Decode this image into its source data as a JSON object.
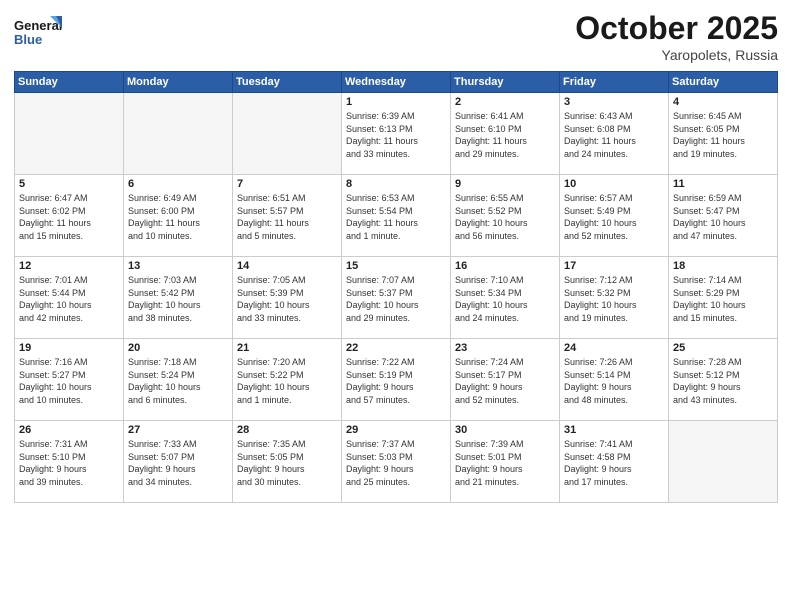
{
  "header": {
    "logo_line1": "General",
    "logo_line2": "Blue",
    "month": "October 2025",
    "location": "Yaropolets, Russia"
  },
  "weekdays": [
    "Sunday",
    "Monday",
    "Tuesday",
    "Wednesday",
    "Thursday",
    "Friday",
    "Saturday"
  ],
  "weeks": [
    [
      {
        "day": "",
        "info": ""
      },
      {
        "day": "",
        "info": ""
      },
      {
        "day": "",
        "info": ""
      },
      {
        "day": "1",
        "info": "Sunrise: 6:39 AM\nSunset: 6:13 PM\nDaylight: 11 hours\nand 33 minutes."
      },
      {
        "day": "2",
        "info": "Sunrise: 6:41 AM\nSunset: 6:10 PM\nDaylight: 11 hours\nand 29 minutes."
      },
      {
        "day": "3",
        "info": "Sunrise: 6:43 AM\nSunset: 6:08 PM\nDaylight: 11 hours\nand 24 minutes."
      },
      {
        "day": "4",
        "info": "Sunrise: 6:45 AM\nSunset: 6:05 PM\nDaylight: 11 hours\nand 19 minutes."
      }
    ],
    [
      {
        "day": "5",
        "info": "Sunrise: 6:47 AM\nSunset: 6:02 PM\nDaylight: 11 hours\nand 15 minutes."
      },
      {
        "day": "6",
        "info": "Sunrise: 6:49 AM\nSunset: 6:00 PM\nDaylight: 11 hours\nand 10 minutes."
      },
      {
        "day": "7",
        "info": "Sunrise: 6:51 AM\nSunset: 5:57 PM\nDaylight: 11 hours\nand 5 minutes."
      },
      {
        "day": "8",
        "info": "Sunrise: 6:53 AM\nSunset: 5:54 PM\nDaylight: 11 hours\nand 1 minute."
      },
      {
        "day": "9",
        "info": "Sunrise: 6:55 AM\nSunset: 5:52 PM\nDaylight: 10 hours\nand 56 minutes."
      },
      {
        "day": "10",
        "info": "Sunrise: 6:57 AM\nSunset: 5:49 PM\nDaylight: 10 hours\nand 52 minutes."
      },
      {
        "day": "11",
        "info": "Sunrise: 6:59 AM\nSunset: 5:47 PM\nDaylight: 10 hours\nand 47 minutes."
      }
    ],
    [
      {
        "day": "12",
        "info": "Sunrise: 7:01 AM\nSunset: 5:44 PM\nDaylight: 10 hours\nand 42 minutes."
      },
      {
        "day": "13",
        "info": "Sunrise: 7:03 AM\nSunset: 5:42 PM\nDaylight: 10 hours\nand 38 minutes."
      },
      {
        "day": "14",
        "info": "Sunrise: 7:05 AM\nSunset: 5:39 PM\nDaylight: 10 hours\nand 33 minutes."
      },
      {
        "day": "15",
        "info": "Sunrise: 7:07 AM\nSunset: 5:37 PM\nDaylight: 10 hours\nand 29 minutes."
      },
      {
        "day": "16",
        "info": "Sunrise: 7:10 AM\nSunset: 5:34 PM\nDaylight: 10 hours\nand 24 minutes."
      },
      {
        "day": "17",
        "info": "Sunrise: 7:12 AM\nSunset: 5:32 PM\nDaylight: 10 hours\nand 19 minutes."
      },
      {
        "day": "18",
        "info": "Sunrise: 7:14 AM\nSunset: 5:29 PM\nDaylight: 10 hours\nand 15 minutes."
      }
    ],
    [
      {
        "day": "19",
        "info": "Sunrise: 7:16 AM\nSunset: 5:27 PM\nDaylight: 10 hours\nand 10 minutes."
      },
      {
        "day": "20",
        "info": "Sunrise: 7:18 AM\nSunset: 5:24 PM\nDaylight: 10 hours\nand 6 minutes."
      },
      {
        "day": "21",
        "info": "Sunrise: 7:20 AM\nSunset: 5:22 PM\nDaylight: 10 hours\nand 1 minute."
      },
      {
        "day": "22",
        "info": "Sunrise: 7:22 AM\nSunset: 5:19 PM\nDaylight: 9 hours\nand 57 minutes."
      },
      {
        "day": "23",
        "info": "Sunrise: 7:24 AM\nSunset: 5:17 PM\nDaylight: 9 hours\nand 52 minutes."
      },
      {
        "day": "24",
        "info": "Sunrise: 7:26 AM\nSunset: 5:14 PM\nDaylight: 9 hours\nand 48 minutes."
      },
      {
        "day": "25",
        "info": "Sunrise: 7:28 AM\nSunset: 5:12 PM\nDaylight: 9 hours\nand 43 minutes."
      }
    ],
    [
      {
        "day": "26",
        "info": "Sunrise: 7:31 AM\nSunset: 5:10 PM\nDaylight: 9 hours\nand 39 minutes."
      },
      {
        "day": "27",
        "info": "Sunrise: 7:33 AM\nSunset: 5:07 PM\nDaylight: 9 hours\nand 34 minutes."
      },
      {
        "day": "28",
        "info": "Sunrise: 7:35 AM\nSunset: 5:05 PM\nDaylight: 9 hours\nand 30 minutes."
      },
      {
        "day": "29",
        "info": "Sunrise: 7:37 AM\nSunset: 5:03 PM\nDaylight: 9 hours\nand 25 minutes."
      },
      {
        "day": "30",
        "info": "Sunrise: 7:39 AM\nSunset: 5:01 PM\nDaylight: 9 hours\nand 21 minutes."
      },
      {
        "day": "31",
        "info": "Sunrise: 7:41 AM\nSunset: 4:58 PM\nDaylight: 9 hours\nand 17 minutes."
      },
      {
        "day": "",
        "info": ""
      }
    ]
  ]
}
